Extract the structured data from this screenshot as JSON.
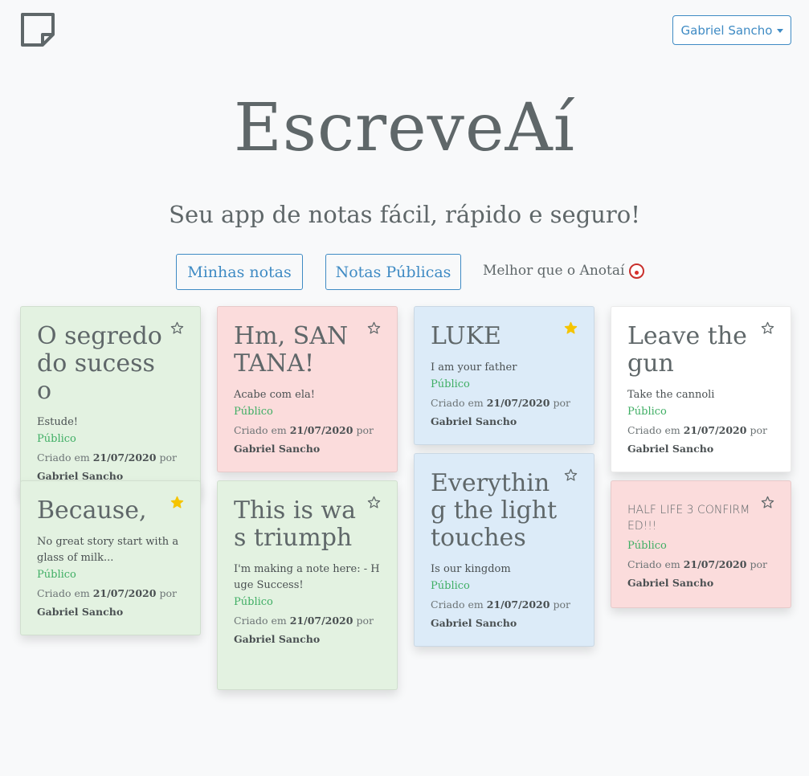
{
  "header": {
    "logo_icon": "sticky-note-icon",
    "user_menu_label": "Gabriel Sancho"
  },
  "hero": {
    "title": "EscreveAí",
    "subtitle": "Seu app de notas fácil, rápido e seguro!"
  },
  "actions": {
    "my_notes_label": "Minhas notas",
    "public_notes_label": "Notas Públicas",
    "tagline": "Melhor que o Anotaí",
    "tagline_icon": "clown-face-icon"
  },
  "colors": {
    "accent": "#3f8bc4",
    "public": "#3fae64",
    "star_active": "#f5c400",
    "green_note": "#e3f2e1",
    "red_note": "#fbdcdc",
    "blue_note": "#dcebf8",
    "white_note": "#ffffff"
  },
  "notes": [
    {
      "title": "O segredo do sucesso",
      "body": "Estude!",
      "visibility": "Público",
      "created_prefix": "Criado em",
      "date": "21/07/2020",
      "by": "por",
      "author": "Gabriel Sancho",
      "starred": false,
      "color": "green"
    },
    {
      "title": "Hm, SANTANA!",
      "body": "Acabe com ela!",
      "visibility": "Público",
      "created_prefix": "Criado em",
      "date": "21/07/2020",
      "by": "por",
      "author": "Gabriel Sancho",
      "starred": false,
      "color": "red"
    },
    {
      "title": "LUKE",
      "body": "I am your father",
      "visibility": "Público",
      "created_prefix": "Criado em",
      "date": "21/07/2020",
      "by": "por",
      "author": "Gabriel Sancho",
      "starred": true,
      "color": "blue"
    },
    {
      "title": "Leave the gun",
      "body": "Take the cannoli",
      "visibility": "Público",
      "created_prefix": "Criado em",
      "date": "21/07/2020",
      "by": "por",
      "author": "Gabriel Sancho",
      "starred": false,
      "color": "white"
    },
    {
      "title": "Because,",
      "body": "No great story start with a glass of milk...",
      "visibility": "Público",
      "created_prefix": "Criado em",
      "date": "21/07/2020",
      "by": "por",
      "author": "Gabriel Sancho",
      "starred": true,
      "color": "green"
    },
    {
      "title": "This is was triumph",
      "body": "I'm making a note here: - Huge Success!",
      "visibility": "Público",
      "created_prefix": "Criado em",
      "date": "21/07/2020",
      "by": "por",
      "author": "Gabriel Sancho",
      "starred": false,
      "color": "green"
    },
    {
      "title": "Everything the light touches",
      "body": "Is our kingdom",
      "visibility": "Público",
      "created_prefix": "Criado em",
      "date": "21/07/2020",
      "by": "por",
      "author": "Gabriel Sancho",
      "starred": false,
      "color": "blue"
    },
    {
      "title": "HALF LIFE 3 CONFIRMED!!!",
      "body": "",
      "visibility": "Público",
      "created_prefix": "Criado em",
      "date": "21/07/2020",
      "by": "por",
      "author": "Gabriel Sancho",
      "starred": false,
      "color": "red"
    }
  ]
}
